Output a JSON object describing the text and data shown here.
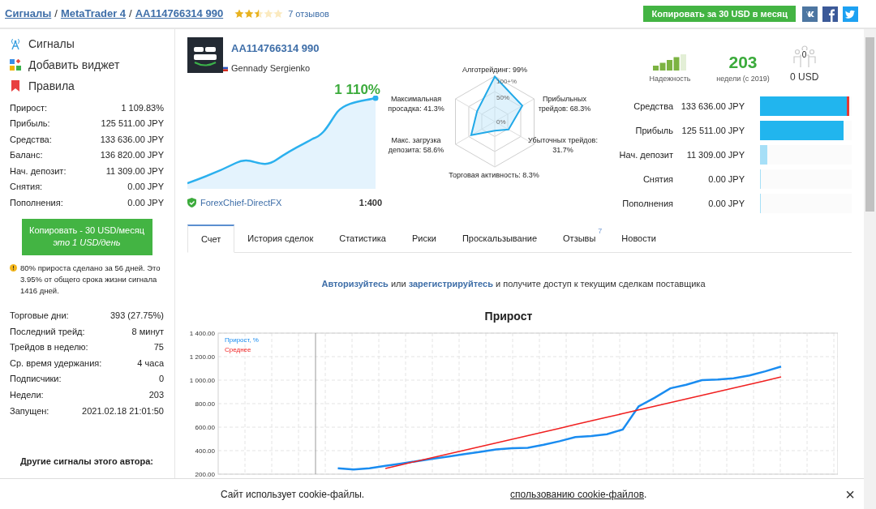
{
  "breadcrumbs": [
    {
      "label": "Сигналы"
    },
    {
      "label": "MetaTrader 4",
      "separator": "/"
    },
    {
      "label": "AA114766314 990",
      "separator": "/"
    }
  ],
  "rating": {
    "stars": 2.5,
    "reviews": "7 отзывов"
  },
  "copy_button": "Копировать за 30 USD в месяц",
  "sidebar": {
    "menu": [
      {
        "label": "Сигналы",
        "kind": "signals"
      },
      {
        "label": "Добавить виджет",
        "kind": "widget"
      },
      {
        "label": "Правила",
        "kind": "rules"
      }
    ],
    "stats": [
      {
        "label": "Прирост:",
        "value": "1 109.83%"
      },
      {
        "label": "Прибыль:",
        "value": "125 511.00 JPY"
      },
      {
        "label": "Средства:",
        "value": "133 636.00 JPY"
      },
      {
        "label": "Баланс:",
        "value": "136 820.00 JPY"
      },
      {
        "label": "Нач. депозит:",
        "value": "11 309.00 JPY"
      },
      {
        "label": "Снятия:",
        "value": "0.00 JPY"
      },
      {
        "label": "Пополнения:",
        "value": "0.00 JPY"
      }
    ],
    "copy_button": {
      "label": "Копировать - 30 USD/месяц",
      "sublabel": "это 1 USD/день"
    },
    "note": "80% прироста сделано за 56 дней. Это 3.95% от общего срока жизни сигнала 1416 дней.",
    "stats_2": [
      {
        "label": "Торговые дни:",
        "value": "393 (27.75%)"
      },
      {
        "label": "Последний трейд:",
        "value": "8 минут"
      },
      {
        "label": "Трейдов в неделю:",
        "value": "75"
      },
      {
        "label": "Ср. время удержания:",
        "value": "4 часа"
      },
      {
        "label": "Подписчики:",
        "value": "0"
      },
      {
        "label": "Недели:",
        "value": "203"
      },
      {
        "label": "Запущен:",
        "value": "2021.02.18 21:01:50"
      }
    ],
    "other_signals_title": "Другие сигналы этого автора:"
  },
  "signal": {
    "title": "AA114766314 990",
    "author": "Gennady Sergienko",
    "growth": "1 110%",
    "broker": "ForexChief-DirectFX",
    "leverage": "1:400"
  },
  "radar": {
    "ticks": [
      "100+%",
      "50%",
      "0%"
    ],
    "axes": [
      {
        "label": "Алготрейдинг: 99%"
      },
      {
        "label": "Максимальная просадка: 41.3%"
      },
      {
        "label": "Прибыльных трейдов: 68.3%"
      },
      {
        "label": "Макс. загрузка депозита: 58.6%"
      },
      {
        "label": "Убыточных трейдов: 31.7%"
      },
      {
        "label": "Торговая активность: 8.3%"
      }
    ]
  },
  "reliability": {
    "label": "Надежность",
    "level": 0.8
  },
  "weeks": {
    "value": "203",
    "label": "недели (с 2019)"
  },
  "subscribers": {
    "count": "0",
    "amount": "0 USD"
  },
  "balance_bars": [
    {
      "label": "Средства",
      "value": "133 636.00 JPY",
      "level": 0.97,
      "color": "#21b5ee",
      "drawdown": true
    },
    {
      "label": "Прибыль",
      "value": "125 511.00 JPY",
      "level": 0.91,
      "color": "#21b5ee",
      "drawdown": false
    },
    {
      "label": "Нач. депозит",
      "value": "11 309.00 JPY",
      "level": 0.08,
      "color": "#a6dff7",
      "drawdown": false
    },
    {
      "label": "Снятия",
      "value": "0.00 JPY",
      "level": 0,
      "color": "#a6dff7",
      "drawdown": false
    },
    {
      "label": "Пополнения",
      "value": "0.00 JPY",
      "level": 0,
      "color": "#a6dff7",
      "drawdown": false
    }
  ],
  "tabs": [
    {
      "label": "Счет",
      "selected": true
    },
    {
      "label": "История сделок",
      "selected": false
    },
    {
      "label": "Статистика",
      "selected": false
    },
    {
      "label": "Риски",
      "selected": false
    },
    {
      "label": "Проскальзывание",
      "selected": false
    },
    {
      "label": "Отзывы",
      "selected": false,
      "badge": "7"
    },
    {
      "label": "Новости",
      "selected": false
    }
  ],
  "auth_notice": {
    "login_link": "Авторизуйтесь",
    "text_1": "или",
    "register_link": "зарегистрируйтесь",
    "text_2": "и получите доступ к текущим сделкам поставщика"
  },
  "chart_data": {
    "type": "line",
    "title": "Прирост",
    "grid": true,
    "ylim": [
      200,
      1400
    ],
    "yticks": [
      {
        "value": 200,
        "label": "200.00"
      },
      {
        "value": 400,
        "label": "400.00"
      },
      {
        "value": 600,
        "label": "600.00"
      },
      {
        "value": 800,
        "label": "800.00"
      },
      {
        "value": 1000,
        "label": "1 000.00"
      },
      {
        "value": 1200,
        "label": "1 200.00"
      },
      {
        "value": 1400,
        "label": "1 400.00"
      }
    ],
    "series": [
      {
        "name": "Прирост, %",
        "color": "#1a8cf0",
        "values": [
          null,
          250,
          240,
          250,
          270,
          290,
          310,
          330,
          350,
          370,
          390,
          410,
          420,
          424,
          450,
          480,
          515,
          525,
          539,
          580,
          776,
          850,
          930,
          960,
          1000,
          1005,
          1015,
          1040,
          1075,
          1115
        ]
      },
      {
        "name": "Среднее",
        "color": "#f02020",
        "values": [
          null,
          null,
          null,
          null,
          248,
          280,
          311,
          342,
          373,
          404,
          435,
          466,
          497,
          528,
          559,
          590,
          622,
          653,
          684,
          715,
          746,
          777,
          808,
          839,
          870,
          902,
          933,
          964,
          995,
          1027
        ]
      }
    ]
  },
  "cookie": {
    "text": "Сайт использует cookie-файлы.",
    "link": "спользованию cookie-файлов",
    "end": ".",
    "close": "×"
  }
}
